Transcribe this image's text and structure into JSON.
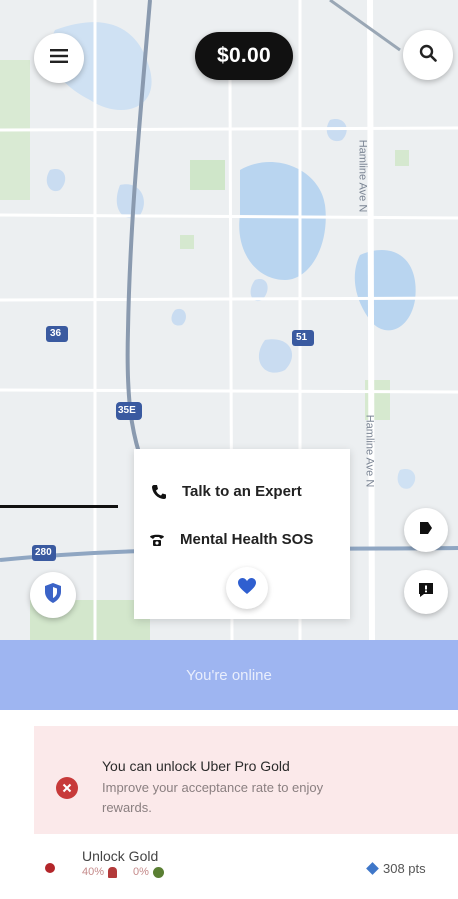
{
  "top_bar": {
    "earnings_display": "$0.00"
  },
  "map": {
    "road_labels": [
      "Hamline Ave N",
      "Hamline Ave N"
    ],
    "route_shields": [
      "36",
      "51",
      "35E",
      "280"
    ]
  },
  "help_popup": {
    "expert_label": "Talk to an Expert",
    "sos_label": "Mental Health SOS"
  },
  "status_bar": {
    "label": "You're online"
  },
  "pro_card": {
    "title": "You can unlock Uber Pro Gold",
    "subtitle": "Improve your acceptance rate to enjoy rewards."
  },
  "gold_row": {
    "title": "Unlock Gold",
    "acceptance_stat": "40%",
    "rating_stat": "0%",
    "points": "308 pts"
  },
  "colors": {
    "online_bar": "#9eb5f1",
    "pro_card_bg": "#fbe9ea",
    "alert_red": "#c73a3a",
    "points_blue": "#3f77c9"
  }
}
